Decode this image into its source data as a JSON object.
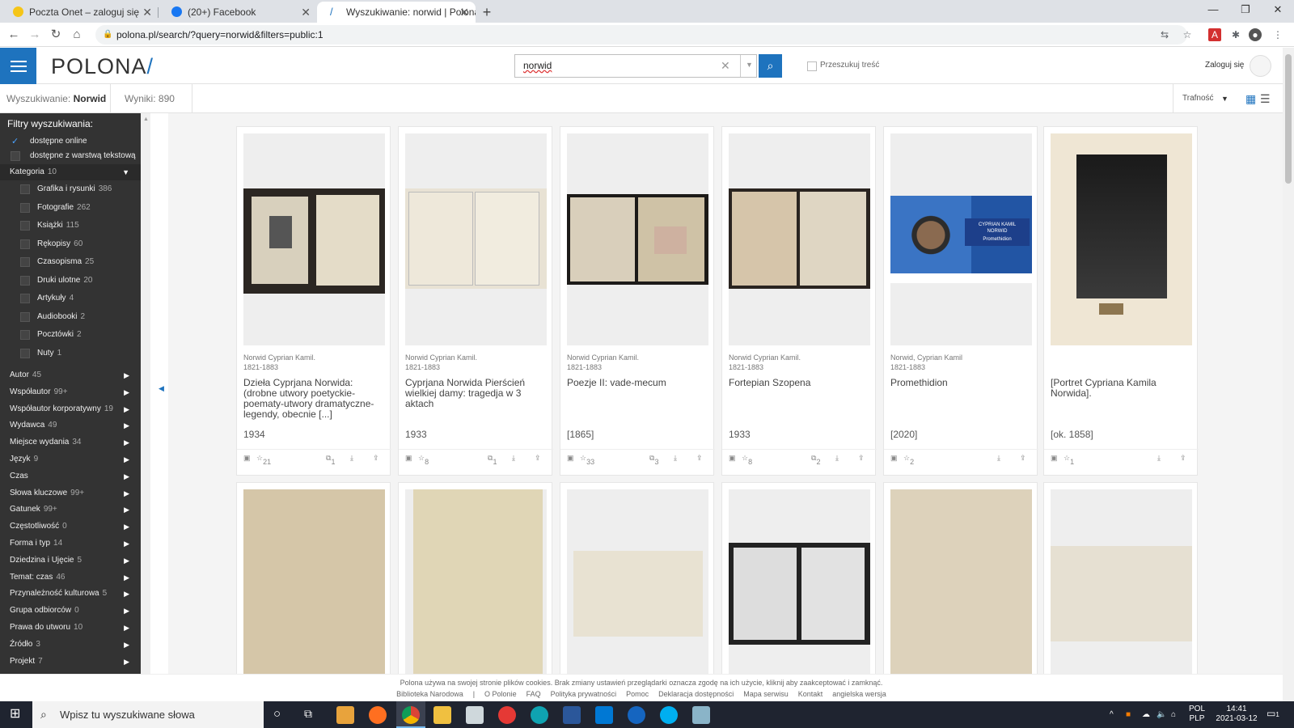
{
  "browser": {
    "tabs": [
      {
        "label": "Poczta Onet – zaloguj się",
        "favicon": "onet-favicon",
        "color": "#f5c518"
      },
      {
        "label": "(20+) Facebook",
        "favicon": "facebook-favicon",
        "color": "#1877f2"
      },
      {
        "label": "Wyszukiwanie: norwid | Polona",
        "favicon": "polona-favicon",
        "color": "#1e73be"
      }
    ],
    "new_tab": "+",
    "url": "polona.pl/search/?query=norwid&filters=public:1"
  },
  "header": {
    "logo_text": "POLONA",
    "logo_slash": "/",
    "search_value": "norwid",
    "search_content_label": "Przeszukuj treść",
    "login_label": "Zaloguj się"
  },
  "infobar": {
    "query_label": "Wyszukiwanie:",
    "query_value": "Norwid",
    "results": "Wyniki: 890",
    "sort_label": "Trafność"
  },
  "sidebar": {
    "title": "Filtry wyszukiwania:",
    "availability": [
      {
        "label": "dostępne online",
        "checked": true
      },
      {
        "label": "dostępne z warstwą tekstową",
        "checked": false
      }
    ],
    "category_header": {
      "label": "Kategoria",
      "count": "10"
    },
    "categories": [
      {
        "label": "Grafika i rysunki",
        "count": "386"
      },
      {
        "label": "Fotografie",
        "count": "262"
      },
      {
        "label": "Książki",
        "count": "115"
      },
      {
        "label": "Rękopisy",
        "count": "60"
      },
      {
        "label": "Czasopisma",
        "count": "25"
      },
      {
        "label": "Druki ulotne",
        "count": "20"
      },
      {
        "label": "Artykuły",
        "count": "4"
      },
      {
        "label": "Audiobooki",
        "count": "2"
      },
      {
        "label": "Pocztówki",
        "count": "2"
      },
      {
        "label": "Nuty",
        "count": "1"
      }
    ],
    "filters": [
      {
        "label": "Autor",
        "count": "45"
      },
      {
        "label": "Współautor",
        "count": "99+"
      },
      {
        "label": "Współautor korporatywny",
        "count": "19"
      },
      {
        "label": "Wydawca",
        "count": "49"
      },
      {
        "label": "Miejsce wydania",
        "count": "34"
      },
      {
        "label": "Język",
        "count": "9"
      },
      {
        "label": "Czas",
        "count": ""
      },
      {
        "label": "Słowa kluczowe",
        "count": "99+"
      },
      {
        "label": "Gatunek",
        "count": "99+"
      },
      {
        "label": "Częstotliwość",
        "count": "0"
      },
      {
        "label": "Forma i typ",
        "count": "14"
      },
      {
        "label": "Dziedzina i Ujęcie",
        "count": "5"
      },
      {
        "label": "Temat: czas",
        "count": "46"
      },
      {
        "label": "Przynależność kulturowa",
        "count": "5"
      },
      {
        "label": "Grupa odbiorców",
        "count": "0"
      },
      {
        "label": "Prawa do utworu",
        "count": "10"
      },
      {
        "label": "Źródło",
        "count": "3"
      },
      {
        "label": "Projekt",
        "count": "7"
      }
    ]
  },
  "results": [
    {
      "author": "Norwid Cyprian Kamil.",
      "dates": "1821-1883",
      "title": "Dzieła Cyprjana Norwida: (drobne utwory poetyckie-poematy-utwory dramatyczne-legendy, obecnie [...]",
      "year": "1934",
      "type_icon": "book-icon",
      "stars": "21",
      "copies": "1"
    },
    {
      "author": "Norwid Cyprian Kamil.",
      "dates": "1821-1883",
      "title": "Cyprjana Norwida Pierścień wielkiej damy: tragedja w 3 aktach",
      "year": "1933",
      "type_icon": "book-icon",
      "stars": "8",
      "copies": "1"
    },
    {
      "author": "Norwid Cyprian Kamil.",
      "dates": "1821-1883",
      "title": "Poezje II: vade-mecum",
      "year": "[1865]",
      "type_icon": "manuscript-icon",
      "stars": "33",
      "copies": "3"
    },
    {
      "author": "Norwid Cyprian Kamil.",
      "dates": "1821-1883",
      "title": "Fortepian Szopena",
      "year": "1933",
      "type_icon": "book-icon",
      "stars": "8",
      "copies": "2"
    },
    {
      "author": "Norwid, Cyprian Kamil",
      "dates": "1821-1883",
      "title": "Promethidion",
      "year": "[2020]",
      "type_icon": "headphones-icon",
      "stars": "2",
      "copies": ""
    },
    {
      "author": "",
      "dates": "",
      "title": "[Portret Cypriana Kamila Norwida].",
      "year": "[ok. 1858]",
      "type_icon": "image-icon",
      "stars": "1",
      "copies": ""
    }
  ],
  "promethidion_cover": {
    "line1": "CYPRIAN KAMIL",
    "line2": "NORWID",
    "line3": "Promethidion"
  },
  "cookie": {
    "text": "Polona używa na swojej stronie plików cookies.   Brak zmiany ustawień przeglądarki oznacza zgodę na ich użycie, kliknij aby zaakceptować i zamknąć.",
    "links": [
      "Biblioteka Narodowa",
      "|",
      "O Polonie",
      "FAQ",
      "Polityka prywatności",
      "Pomoc",
      "Deklaracja dostępności",
      "Mapa serwisu",
      "Kontakt",
      "angielska wersja"
    ]
  },
  "taskbar": {
    "search_placeholder": "Wpisz tu wyszukiwane słowa",
    "lang1": "POL",
    "lang2": "PLP",
    "time": "14:41",
    "date": "2021-03-12",
    "notif": "1"
  }
}
